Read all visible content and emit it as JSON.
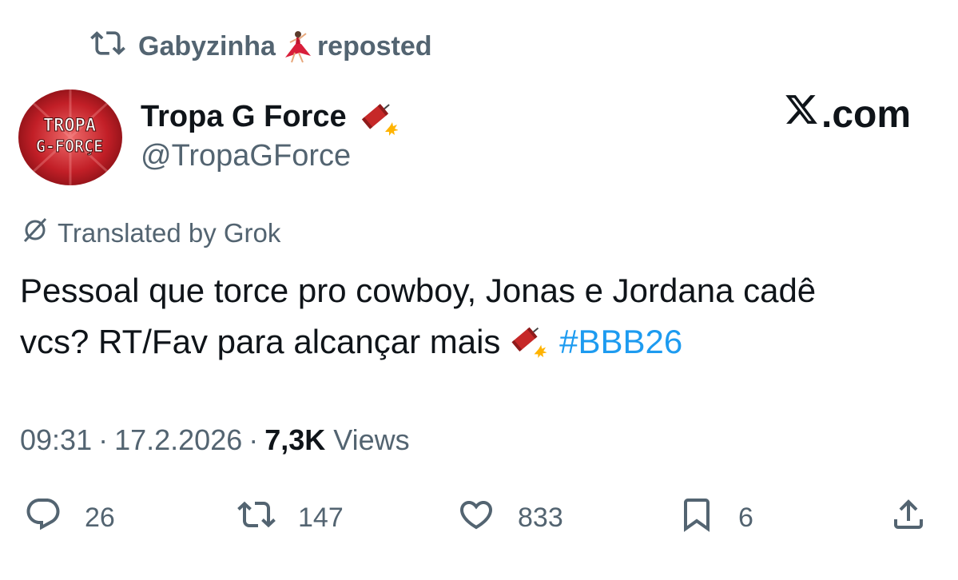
{
  "repost": {
    "icon": "repost-icon",
    "user": "Gabyzinha",
    "emoji": "dancer-emoji",
    "suffix": "reposted"
  },
  "author": {
    "avatar_text_line1": "TROPA",
    "avatar_text_line2": "G-FORÇE",
    "display_name": "Tropa G Force",
    "name_emoji": "firecracker-emoji",
    "handle": "@TropaGForce"
  },
  "brand": {
    "logo": "x-logo-icon",
    "domain_suffix": ".com"
  },
  "translation": {
    "icon": "grok-icon",
    "label": "Translated by Grok"
  },
  "tweet": {
    "text_line1": "Pessoal que torce pro cowboy, Jonas e Jordana cadê",
    "text_line2": "vcs? RT/Fav para alcançar mais",
    "hashtag": "#BBB26"
  },
  "meta": {
    "time": "09:31",
    "date": "17.2.2026",
    "views_count": "7,3K",
    "views_label": "Views"
  },
  "actions": {
    "replies": "26",
    "reposts": "147",
    "likes": "833",
    "bookmarks": "6"
  },
  "colors": {
    "text": "#0f1419",
    "secondary": "#536471",
    "link": "#1d9bf0"
  }
}
